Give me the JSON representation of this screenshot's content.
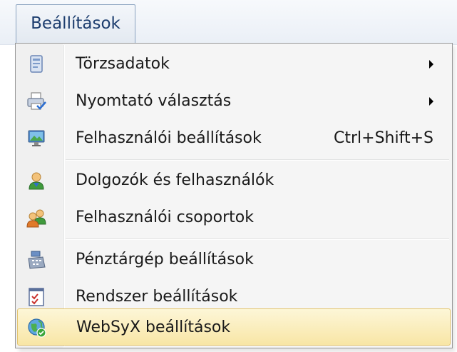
{
  "menubar": {
    "active_menu": "Beállítások"
  },
  "menu": {
    "items": [
      {
        "label": "Törzsadatok",
        "icon": "master-data-icon",
        "submenu": true
      },
      {
        "label": "Nyomtató választás",
        "icon": "printer-icon",
        "submenu": true
      },
      {
        "label": "Felhasználói beállítások",
        "icon": "monitor-icon",
        "shortcut": "Ctrl+Shift+S"
      },
      {
        "label": "Dolgozók és felhasználók",
        "icon": "user-icon"
      },
      {
        "label": "Felhasználói csoportok",
        "icon": "user-group-icon"
      },
      {
        "label": "Pénztárgép beállítások",
        "icon": "cash-register-icon"
      },
      {
        "label": "Rendszer beállítások",
        "icon": "system-checklist-icon"
      },
      {
        "label": "WebSyX beállítások",
        "icon": "globe-icon",
        "highlighted": true
      }
    ]
  },
  "colors": {
    "highlight_top": "#fdf6d7",
    "highlight_bottom": "#f8e6a6",
    "highlight_border": "#e3c46e",
    "menubar_text": "#1c3d6e"
  }
}
